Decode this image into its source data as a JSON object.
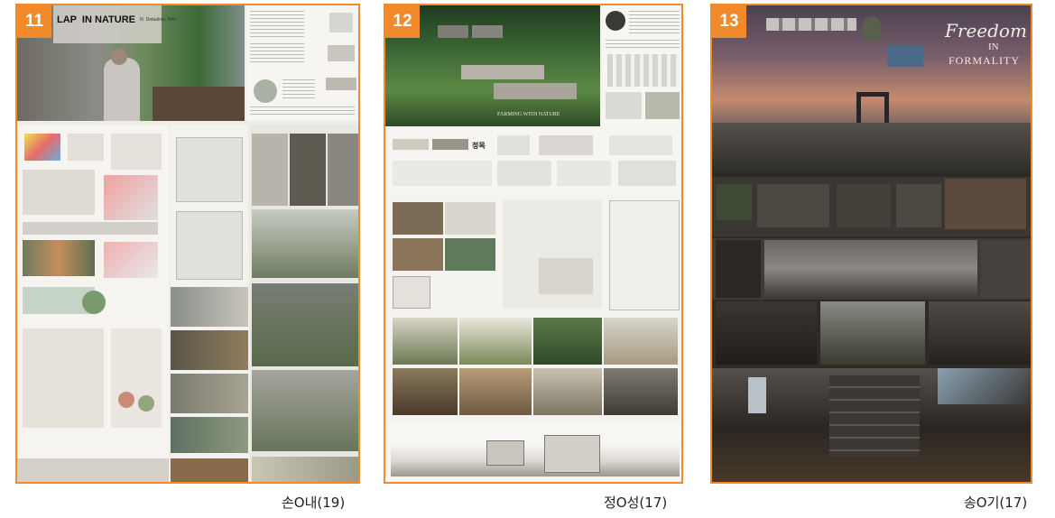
{
  "posters": [
    {
      "number": "11",
      "title_fragment": "LAP  IN NATURE",
      "subtitle_fragment": "Ilt  Detaalnm  Nrth",
      "caption": "손O내(19)"
    },
    {
      "number": "12",
      "image_text": "FARMING WITH NATURE",
      "label_fragment": "정목",
      "caption": "정O성(17)"
    },
    {
      "number": "13",
      "title_lines": [
        "Freedom",
        "IN",
        "FORMALITY"
      ],
      "caption": "송O기(17)"
    }
  ],
  "colors": {
    "accent": "#f08a2a",
    "caption_text": "#222222"
  }
}
